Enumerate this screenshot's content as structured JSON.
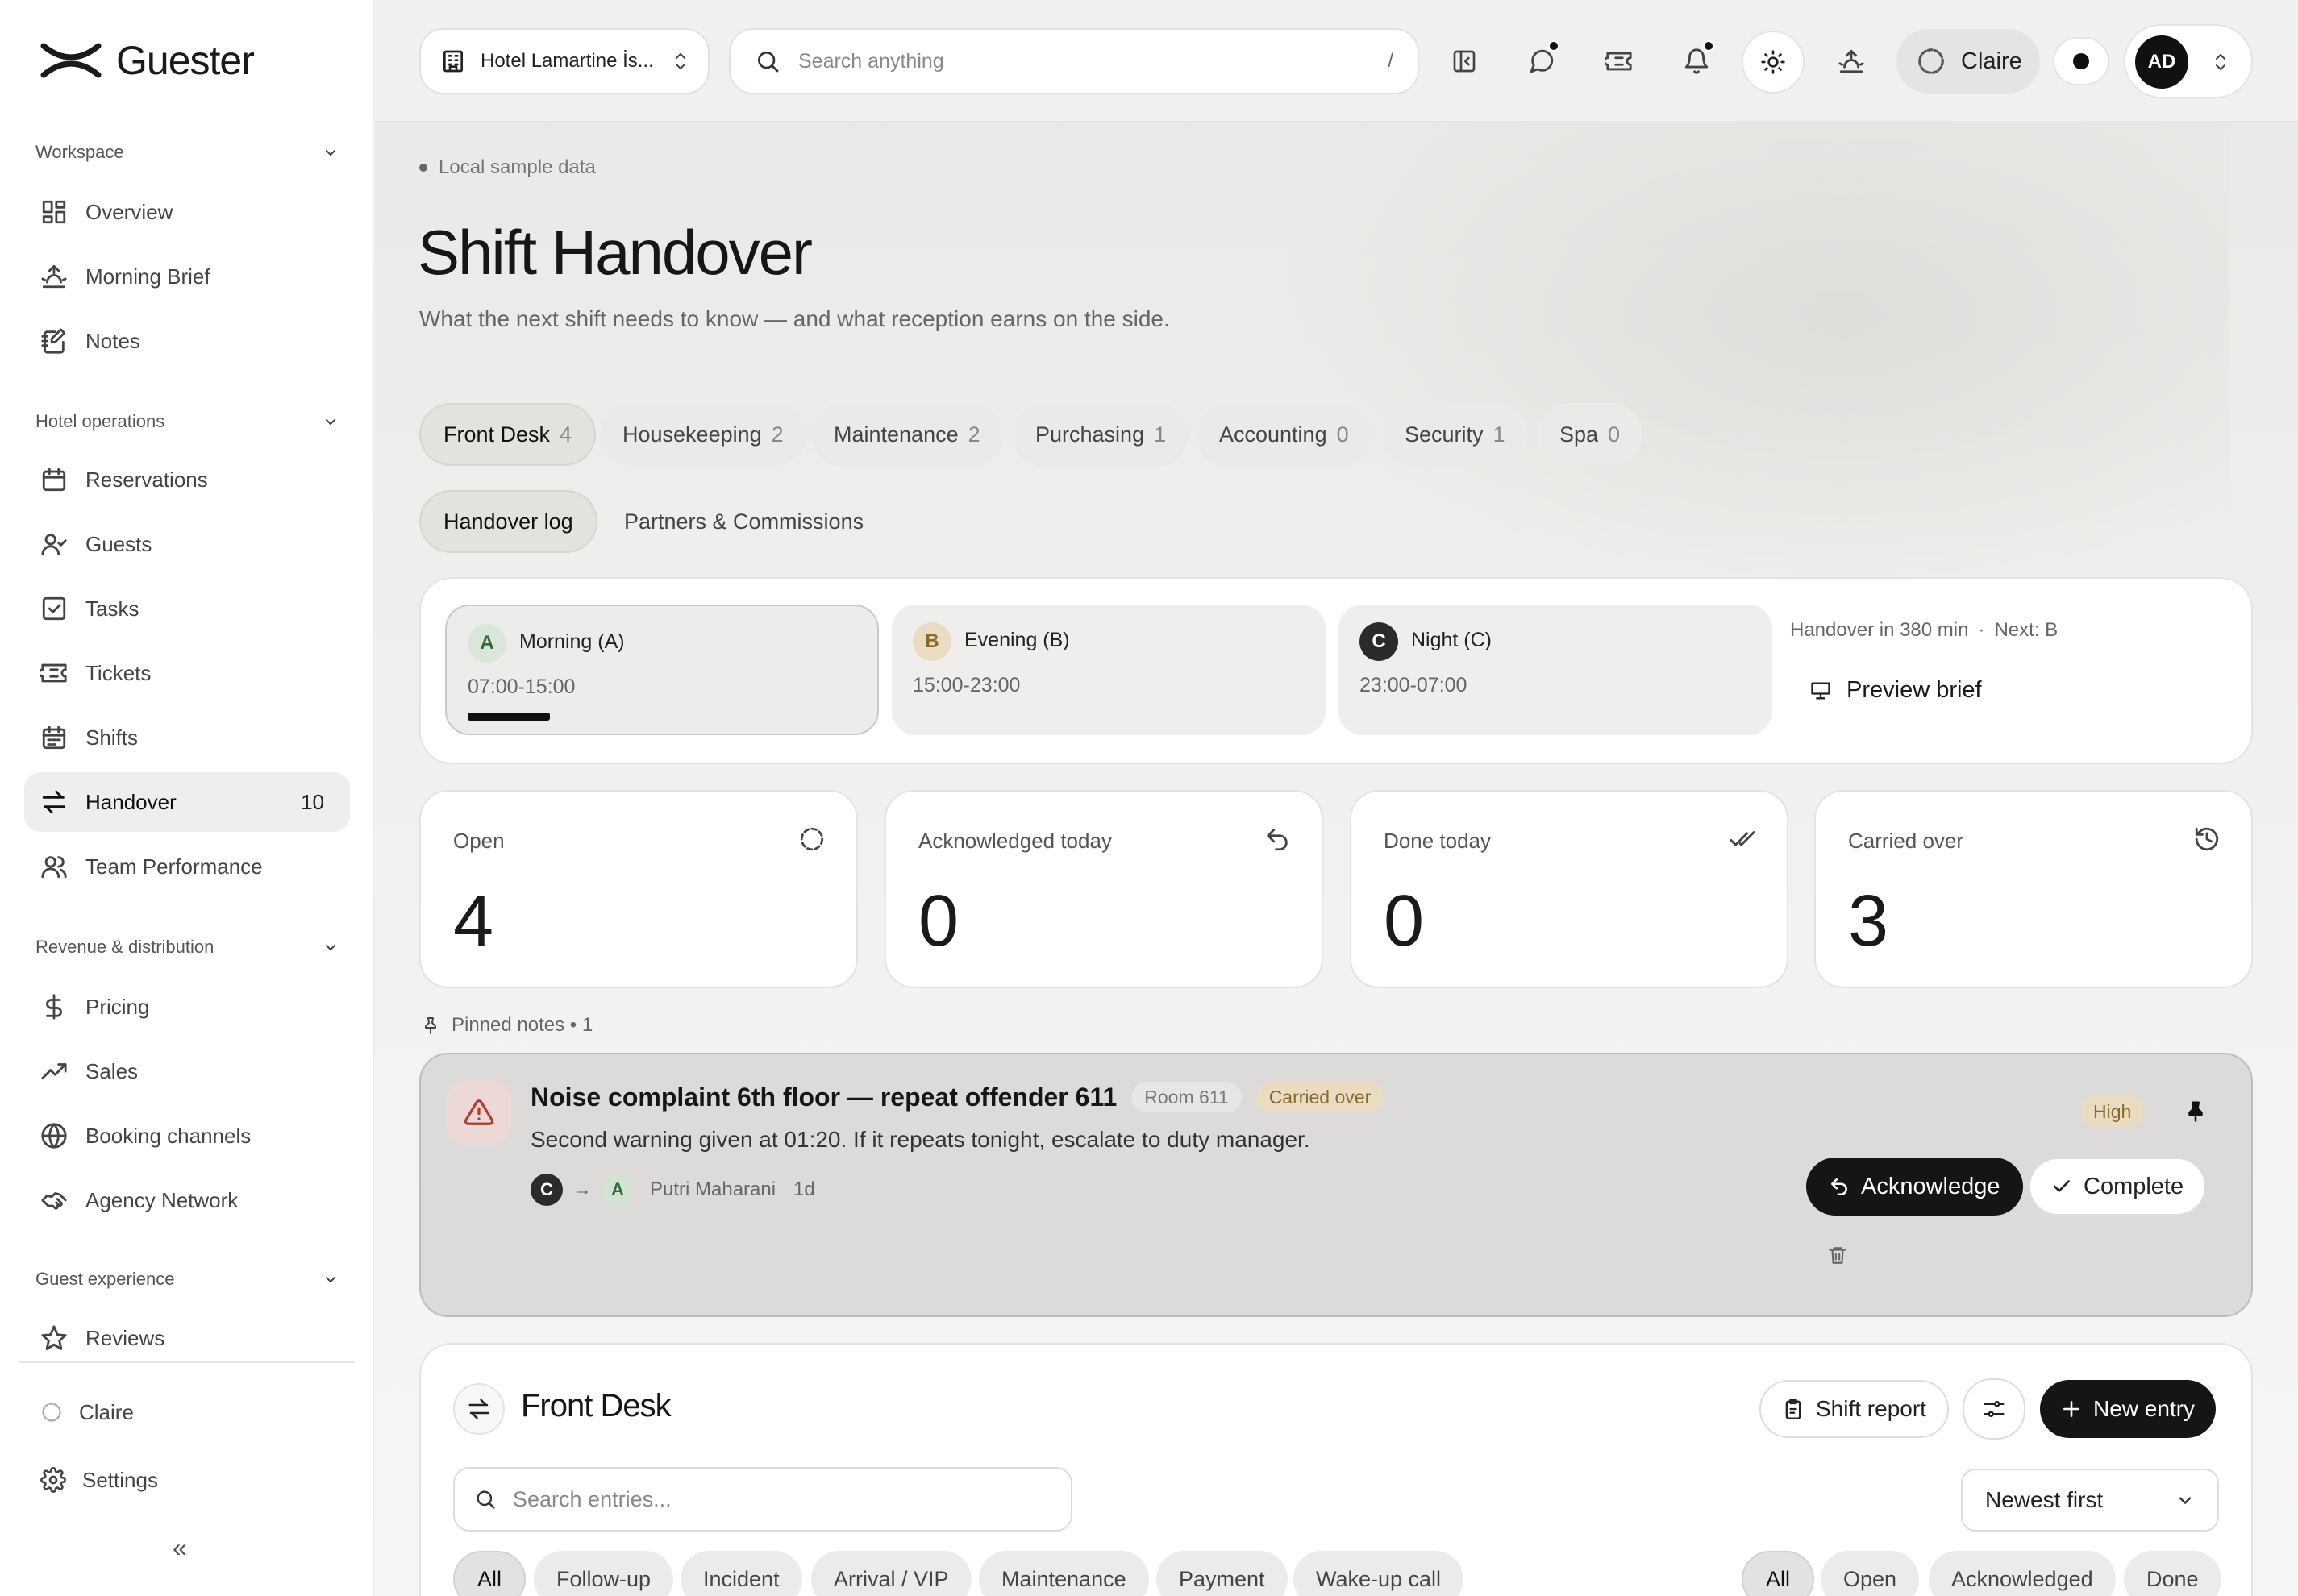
{
  "app": {
    "name": "Guester"
  },
  "sidebar": {
    "sections": {
      "workspace": "Workspace",
      "hotel_ops": "Hotel operations",
      "revenue": "Revenue & distribution",
      "guest_exp": "Guest experience"
    },
    "items": {
      "overview": "Overview",
      "morning_brief": "Morning Brief",
      "notes": "Notes",
      "reservations": "Reservations",
      "guests": "Guests",
      "tasks": "Tasks",
      "tickets": "Tickets",
      "shifts": "Shifts",
      "handover": "Handover",
      "handover_count": "10",
      "team_performance": "Team Performance",
      "pricing": "Pricing",
      "sales": "Sales",
      "booking_channels": "Booking channels",
      "agency_network": "Agency Network",
      "reviews": "Reviews"
    },
    "footer": {
      "claire": "Claire",
      "settings": "Settings",
      "collapse": "«"
    }
  },
  "topbar": {
    "hotel": "Hotel Lamartine İs...",
    "search_placeholder": "Search anything",
    "search_shortcut": "/",
    "assistant": "Claire",
    "user_initials": "AD"
  },
  "page": {
    "crumb": "Local sample data",
    "title": "Shift Handover",
    "subtitle": "What the next shift needs to know — and what reception earns on the side."
  },
  "departments": [
    {
      "label": "Front Desk",
      "count": "4"
    },
    {
      "label": "Housekeeping",
      "count": "2"
    },
    {
      "label": "Maintenance",
      "count": "2"
    },
    {
      "label": "Purchasing",
      "count": "1"
    },
    {
      "label": "Accounting",
      "count": "0"
    },
    {
      "label": "Security",
      "count": "1"
    },
    {
      "label": "Spa",
      "count": "0"
    }
  ],
  "views": {
    "log": "Handover log",
    "partners": "Partners & Commissions"
  },
  "shifts": [
    {
      "letter": "A",
      "name": "Morning (A)",
      "time": "07:00-15:00"
    },
    {
      "letter": "B",
      "name": "Evening (B)",
      "time": "15:00-23:00"
    },
    {
      "letter": "C",
      "name": "Night (C)",
      "time": "23:00-07:00"
    }
  ],
  "handover_info": {
    "countdown": "Handover in 380 min",
    "sep": "·",
    "next": "Next: B",
    "preview": "Preview brief"
  },
  "stats": [
    {
      "label": "Open",
      "value": "4"
    },
    {
      "label": "Acknowledged today",
      "value": "0"
    },
    {
      "label": "Done today",
      "value": "0"
    },
    {
      "label": "Carried over",
      "value": "3"
    }
  ],
  "pinned": {
    "header": "Pinned notes • 1",
    "title": "Noise complaint 6th floor — repeat offender 611",
    "room": "Room 611",
    "tag": "Carried over",
    "body": "Second warning given at 01:20. If it repeats tonight, escalate to duty manager.",
    "from": "C",
    "to": "A",
    "arrow": "→",
    "author": "Putri Maharani",
    "age": "1d",
    "priority": "High",
    "ack": "Acknowledge",
    "complete": "Complete"
  },
  "section": {
    "title": "Front Desk",
    "shift_report": "Shift report",
    "new_entry": "New entry",
    "search_placeholder": "Search entries...",
    "sort": "Newest first"
  },
  "type_filters": [
    "All",
    "Follow-up",
    "Incident",
    "Arrival / VIP",
    "Maintenance",
    "Payment",
    "Wake-up call"
  ],
  "status_filters": [
    "All",
    "Open",
    "Acknowledged",
    "Done"
  ]
}
